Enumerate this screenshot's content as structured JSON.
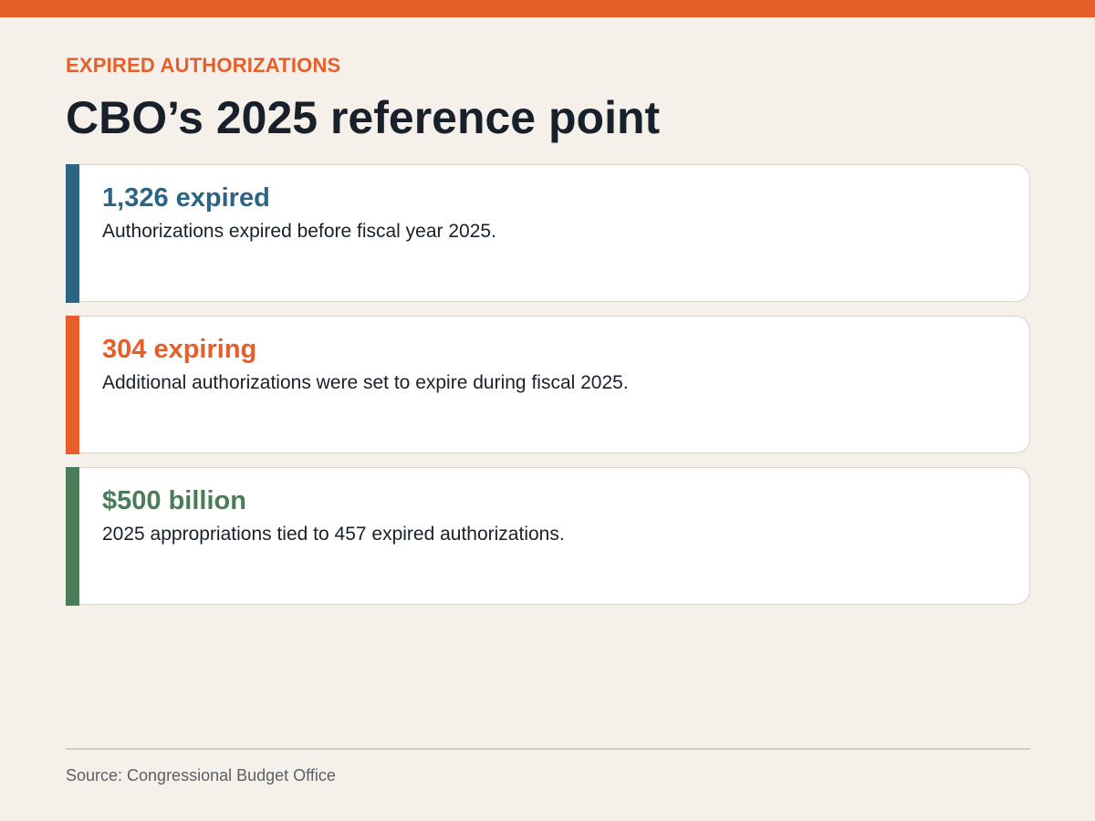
{
  "header": {
    "eyebrow": "EXPIRED AUTHORIZATIONS",
    "title": "CBO’s 2025 reference point"
  },
  "colors": {
    "brand_orange": "#e65f2b",
    "blue": "#2b6484",
    "orange": "#e65f2b",
    "green": "#4a7c59",
    "background": "#f6f0ea",
    "text": "#17202b"
  },
  "cards": [
    {
      "headline": "1,326 expired",
      "body": "Authorizations expired before fiscal year 2025.",
      "accent": "#2b6484"
    },
    {
      "headline": "304 expiring",
      "body": "Additional authorizations were set to expire during fiscal 2025.",
      "accent": "#e65f2b"
    },
    {
      "headline": "$500 billion",
      "body": "2025 appropriations tied to 457 expired authorizations.",
      "accent": "#4a7c59"
    }
  ],
  "footer": {
    "source": "Source: Congressional Budget Office"
  }
}
